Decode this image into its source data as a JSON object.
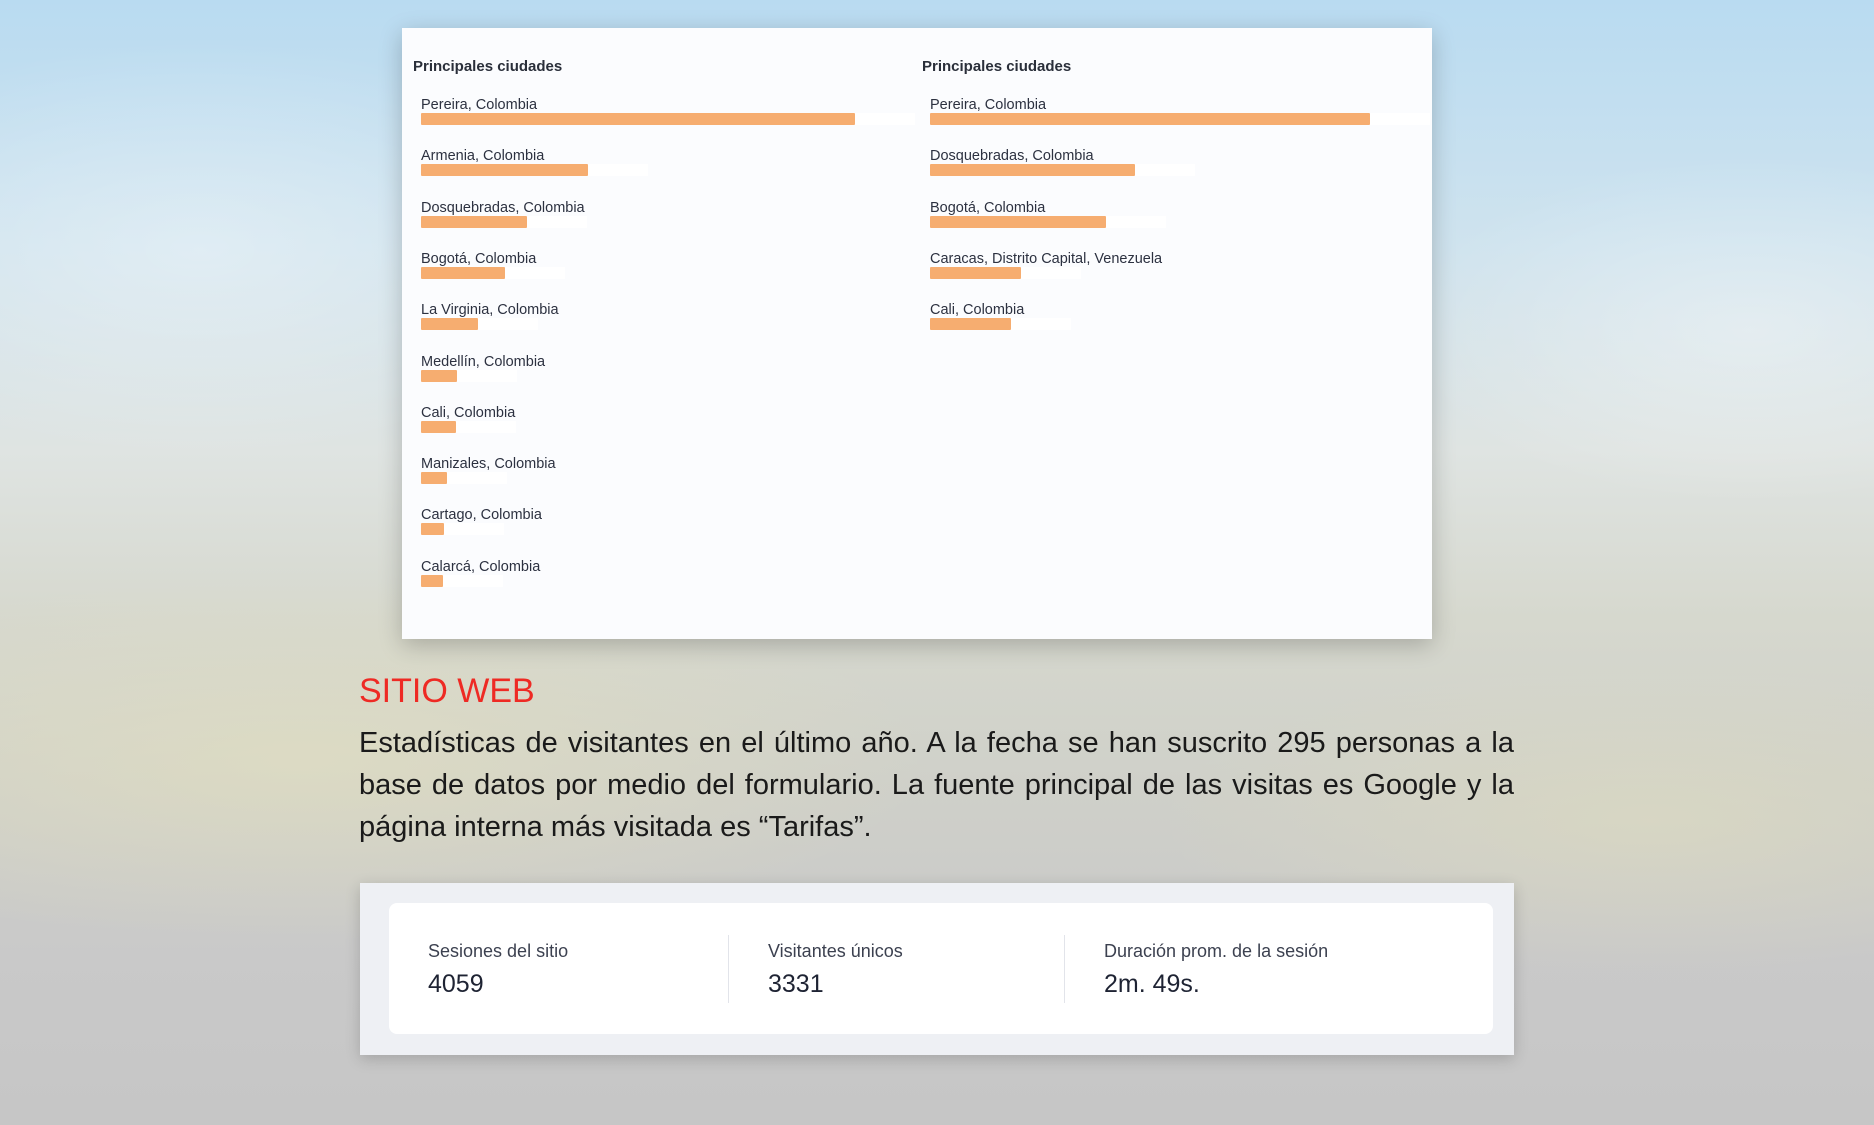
{
  "colors": {
    "bar": "#f6ad70",
    "section_title": "#ee2a24"
  },
  "left_panel": {
    "title": "Principales ciudades",
    "cities": [
      {
        "label": "Pereira, Colombia",
        "value": 100
      },
      {
        "label": "Armenia, Colombia",
        "value": 38.5
      },
      {
        "label": "Dosquebradas, Colombia",
        "value": 24.5
      },
      {
        "label": "Bogotá, Colombia",
        "value": 19.3
      },
      {
        "label": "La Virginia, Colombia",
        "value": 13.2
      },
      {
        "label": "Medellín, Colombia",
        "value": 8.3
      },
      {
        "label": "Cali, Colombia",
        "value": 8
      },
      {
        "label": "Manizales, Colombia",
        "value": 6.1
      },
      {
        "label": "Cartago, Colombia",
        "value": 5.2
      },
      {
        "label": "Calarcá, Colombia",
        "value": 5
      }
    ]
  },
  "right_panel": {
    "title": "Principales ciudades",
    "cities": [
      {
        "label": "Pereira, Colombia",
        "value": 100
      },
      {
        "label": "Dosquebradas, Colombia",
        "value": 46.6
      },
      {
        "label": "Bogotá, Colombia",
        "value": 40
      },
      {
        "label": "Caracas, Distrito Capital, Venezuela",
        "value": 20.7
      },
      {
        "label": "Cali, Colombia",
        "value": 18.5
      }
    ]
  },
  "section": {
    "title": "SITIO WEB",
    "description": "Estadísticas de visitantes en el último año. A la fecha se han suscrito 295 personas a la base de datos por medio del formulario. La fuente principal de las visitas es Google y la página interna más visitada es “Tarifas”."
  },
  "stats": [
    {
      "label": "Sesiones del sitio",
      "value": "4059"
    },
    {
      "label": "Visitantes únicos",
      "value": "3331"
    },
    {
      "label": "Duración prom. de la sesión",
      "value": "2m. 49s."
    }
  ]
}
